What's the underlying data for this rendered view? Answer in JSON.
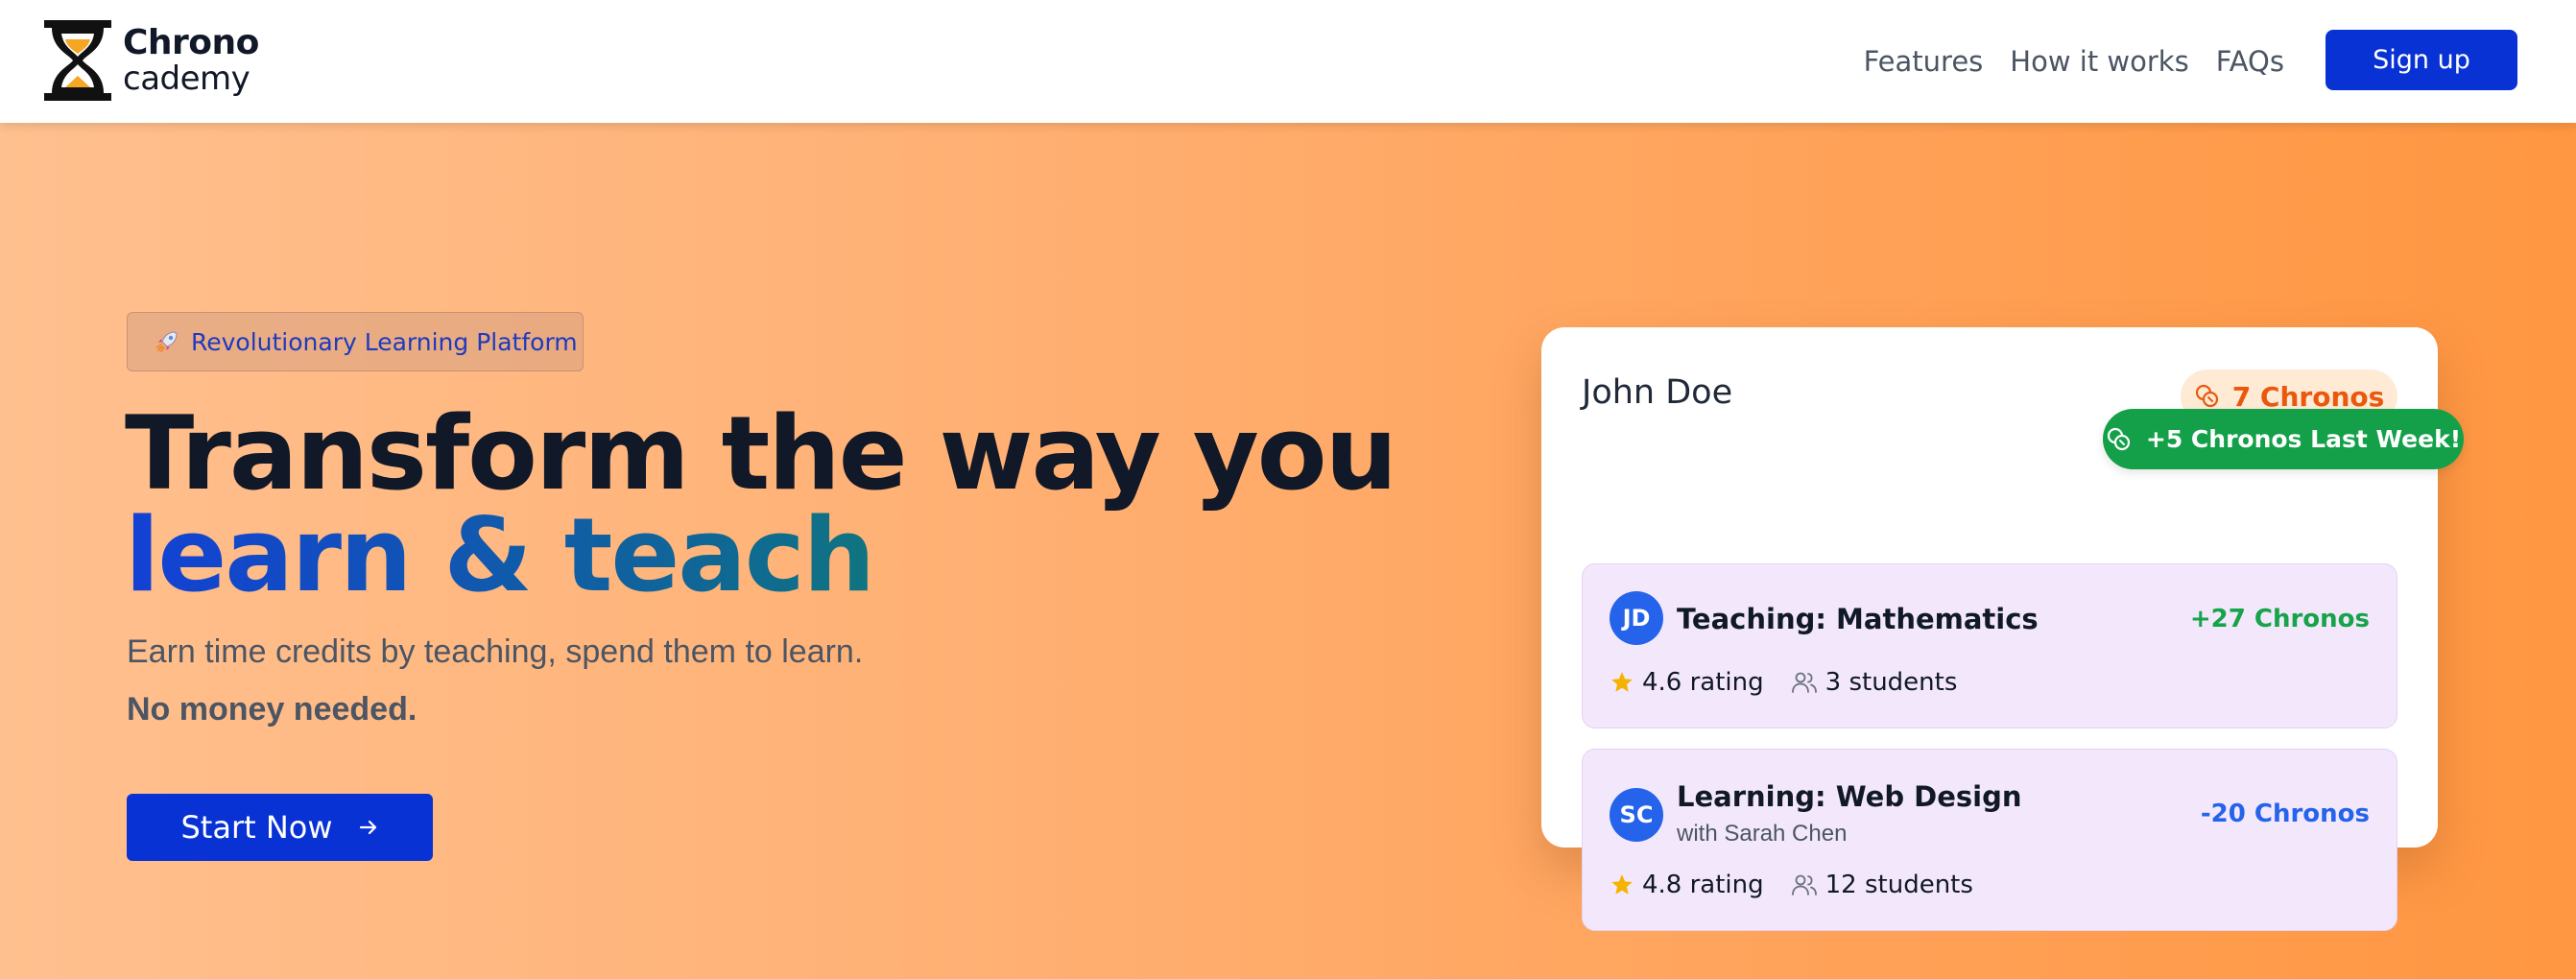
{
  "brand": {
    "name_line1": "Chrono",
    "name_line2": "cademy"
  },
  "nav": {
    "links": [
      {
        "label": "Features"
      },
      {
        "label": "How it works"
      },
      {
        "label": "FAQs"
      }
    ],
    "signup_label": "Sign up"
  },
  "hero": {
    "badge_label": "Revolutionary Learning Platform",
    "headline_line1": "Transform the way you",
    "headline_line2": "learn & teach",
    "subtitle": "Earn time credits by teaching, spend them to learn.",
    "subtitle_bold": "No money needed.",
    "cta_label": "Start Now"
  },
  "card": {
    "user_name": "John Doe",
    "balance_label": "7 Chronos",
    "weekly_badge": "+5 Chronos Last Week!",
    "transactions": [
      {
        "initials": "JD",
        "title": "Teaching: Mathematics",
        "subtitle": "",
        "amount": "+27 Chronos",
        "rating": "4.6 rating",
        "students": "3 students"
      },
      {
        "initials": "SC",
        "title": "Learning: Web Design",
        "subtitle": "with Sarah Chen",
        "amount": "-20 Chronos",
        "rating": "4.8 rating",
        "students": "12 students"
      }
    ]
  },
  "colors": {
    "primary": "#0932d4",
    "accent_orange": "#ea580c",
    "success_green": "#16a34a",
    "badge_green": "#13a049",
    "hero_gradient_start": "#ffc08f",
    "hero_gradient_end": "#ff9641"
  },
  "icons": {
    "logo": "hourglass-icon",
    "badge": "rocket-icon",
    "cta": "arrow-right-icon",
    "balance": "coins-icon",
    "rating": "star-icon",
    "students": "users-icon"
  }
}
